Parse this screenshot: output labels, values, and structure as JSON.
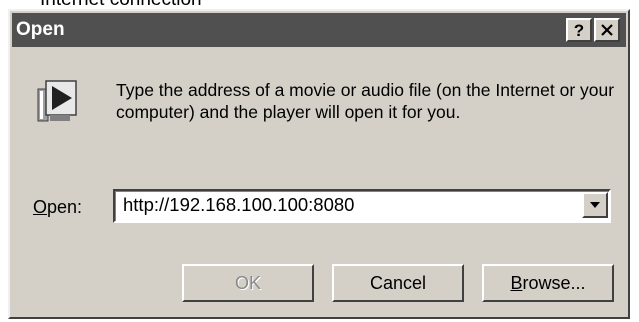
{
  "background_caption": "Internet connection",
  "dialog": {
    "title": "Open",
    "help_label": "?",
    "close_label": "✕",
    "description": "Type the address of a movie or audio file (on the Internet or your computer) and the player will open it for you.",
    "open_label_accel": "O",
    "open_label_rest": "pen:",
    "url_value": "http://192.168.100.100:8080",
    "buttons": {
      "ok": "OK",
      "cancel": "Cancel",
      "browse_accel": "B",
      "browse_rest": "rowse..."
    },
    "icons": {
      "app": "media-player-icon",
      "dropdown": "chevron-down-icon"
    },
    "colors": {
      "titlebar": "#505050",
      "face": "#d4d0c8"
    }
  }
}
